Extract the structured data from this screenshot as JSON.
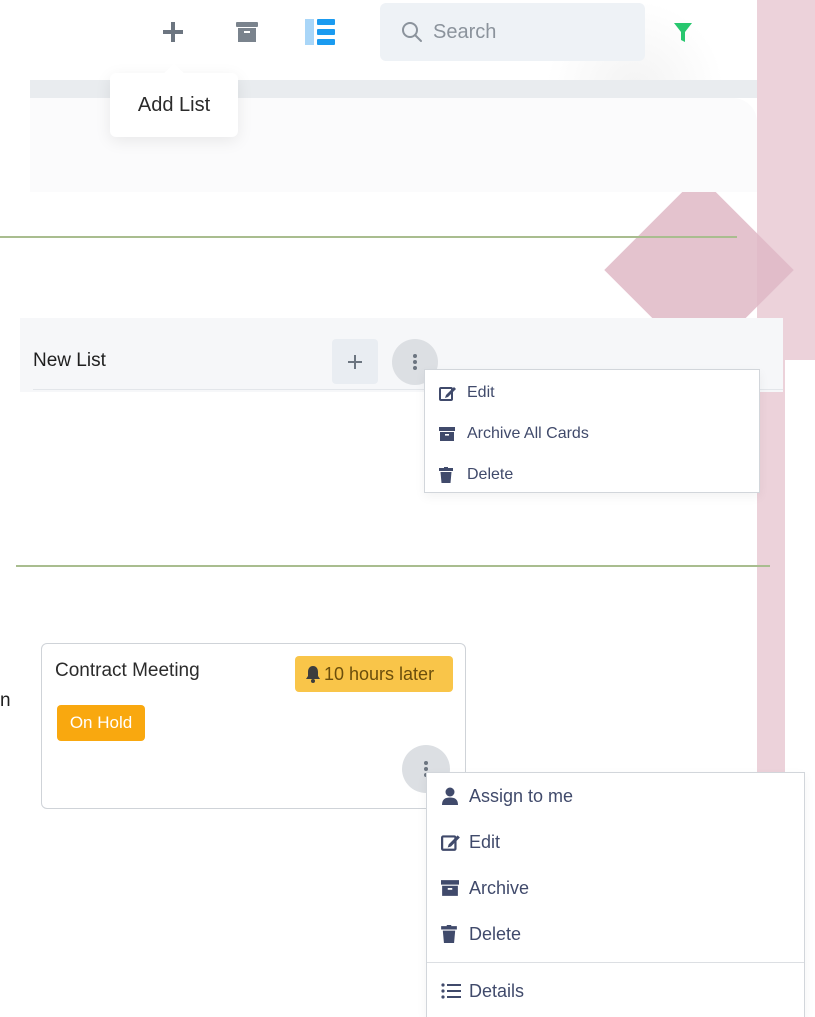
{
  "colors": {
    "accent_blue": "#1a9bf0",
    "filter_green": "#28c76f",
    "due_badge": "#f9c549",
    "status_badge": "#f9a80f",
    "menu_text": "#404a6b",
    "divider": "#a9bd8f",
    "decor_pink": "#ecd2da"
  },
  "toolbar": {
    "add_icon": "plus-icon",
    "archive_icon": "archive-icon",
    "view_icon": "list-view-icon",
    "filter_icon": "filter-icon",
    "add_tooltip": "Add List"
  },
  "search": {
    "placeholder": "Search",
    "icon": "search-icon"
  },
  "list": {
    "title": "New List",
    "add_icon": "plus-icon",
    "menu_icon": "vertical-dots-icon",
    "menu": [
      {
        "label": "Edit",
        "icon": "edit-icon"
      },
      {
        "label": "Archive All Cards",
        "icon": "archive-icon"
      },
      {
        "label": "Delete",
        "icon": "trash-icon"
      }
    ]
  },
  "card": {
    "title": "Contract Meeting",
    "due": "10 hours later",
    "due_icon": "bell-icon",
    "status": "On Hold",
    "menu_icon": "vertical-dots-icon",
    "menu": [
      {
        "label": "Assign to me",
        "icon": "user-icon"
      },
      {
        "label": "Edit",
        "icon": "edit-icon"
      },
      {
        "label": "Archive",
        "icon": "archive-icon"
      },
      {
        "label": "Delete",
        "icon": "trash-icon"
      },
      {
        "label": "Details",
        "icon": "list-icon"
      }
    ]
  },
  "edge_fragment": "n"
}
